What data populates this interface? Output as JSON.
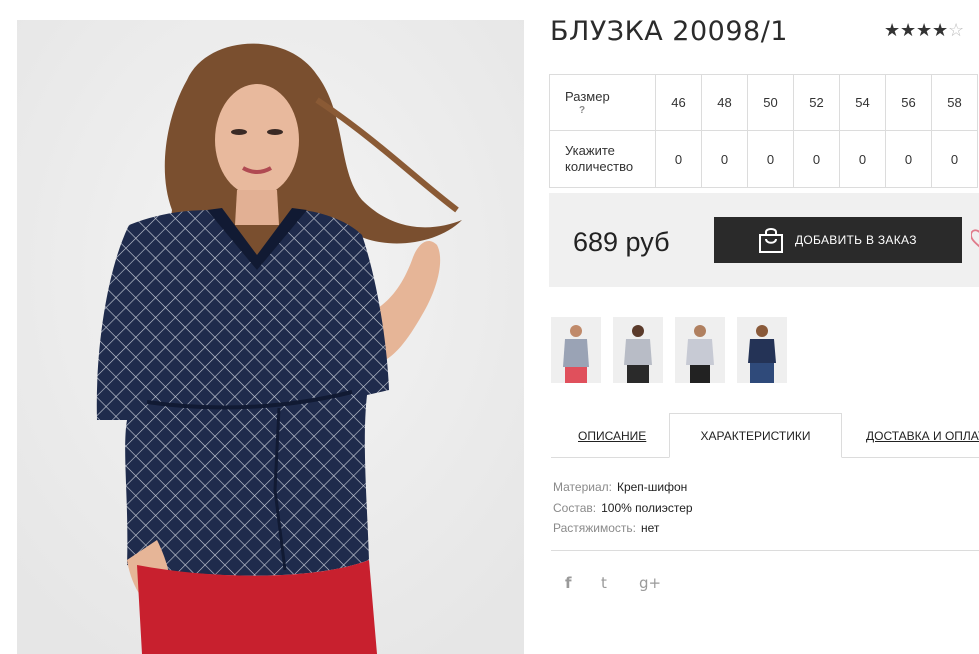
{
  "product": {
    "title": "БЛУЗКА 20098/1",
    "rating": {
      "value": 4,
      "max": 5
    }
  },
  "sizes": {
    "size_label": "Размер",
    "help_mark": "?",
    "qty_label_line1": "Укажите",
    "qty_label_line2": "количество",
    "values": [
      "46",
      "48",
      "50",
      "52",
      "54",
      "56",
      "58"
    ],
    "quantities": [
      "0",
      "0",
      "0",
      "0",
      "0",
      "0",
      "0"
    ]
  },
  "purchase": {
    "price": "689 руб",
    "add_button": "ДОБАВИТЬ В ЗАКАЗ"
  },
  "tabs": [
    {
      "label": "ОПИСАНИЕ",
      "active": false
    },
    {
      "label": "ХАРАКТЕРИСТИКИ",
      "active": true
    },
    {
      "label": "ДОСТАВКА И ОПЛАТА",
      "active": false
    }
  ],
  "specs": [
    {
      "key": "Материал:",
      "value": "Креп-шифон"
    },
    {
      "key": "Состав:",
      "value": "100% полиэстер"
    },
    {
      "key": "Растяжимость:",
      "value": "нет"
    }
  ],
  "social": [
    {
      "icon": "facebook-icon",
      "glyph": "f"
    },
    {
      "icon": "twitter-icon",
      "glyph": "t"
    },
    {
      "icon": "google-plus-icon",
      "glyph": "g+"
    }
  ],
  "colors": {
    "button_bg": "#2a2a2a",
    "price_box_bg": "#f0f0f0",
    "heart": "#e07a8a",
    "blouse": "#1d2a4a",
    "skirt": "#c8202e"
  }
}
